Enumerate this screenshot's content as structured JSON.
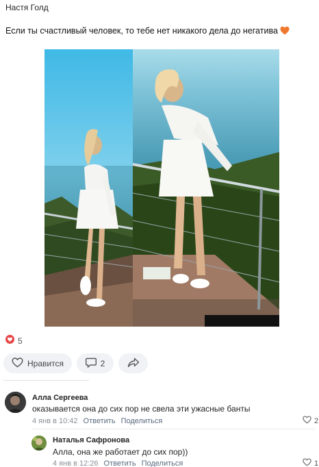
{
  "post": {
    "author": "Настя Голд",
    "text": "Если ты счастливый человек, то тебе нет никакого дела до негатива",
    "likes_count": "5"
  },
  "actions": {
    "like_label": "Нравится",
    "comment_count": "2"
  },
  "comments": [
    {
      "author": "Алла Сергеева",
      "text": "оказывается она до сих пор не свела эти ужасные банты",
      "date": "4 янв в 10:42",
      "reply": "Ответить",
      "share": "Поделиться",
      "likes": "2"
    },
    {
      "author": "Наталья Сафронова",
      "text": "Алла, она же работает до сих пор))",
      "date": "4 янв в 12:26",
      "reply": "Ответить",
      "share": "Поделиться",
      "likes": "1"
    }
  ],
  "colors": {
    "like_heart": "#e64646",
    "emoji_heart": "#f0772e",
    "button_bg": "#f0f2f5"
  }
}
